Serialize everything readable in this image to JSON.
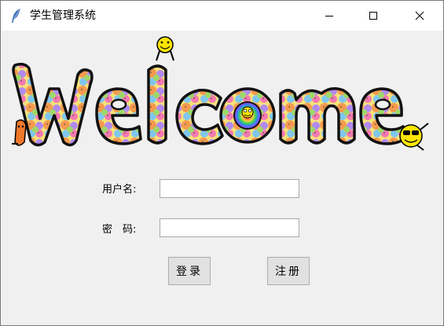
{
  "window": {
    "title": "学生管理系统"
  },
  "banner": {
    "text": "welcome"
  },
  "form": {
    "username_label": "用户名:",
    "password_label": "密　码:",
    "username_value": "",
    "password_value": ""
  },
  "buttons": {
    "login": "登录",
    "register": "注册"
  },
  "colors": {
    "titlebar": "#ffffff",
    "client_bg": "#f0f0f0",
    "button_bg": "#e1e1e1",
    "button_border": "#adadad",
    "entry_border": "#a9a9a9"
  },
  "icons": {
    "app": "tk-feather-icon",
    "minimize": "minimize-icon",
    "maximize": "maximize-icon",
    "close": "close-icon"
  }
}
